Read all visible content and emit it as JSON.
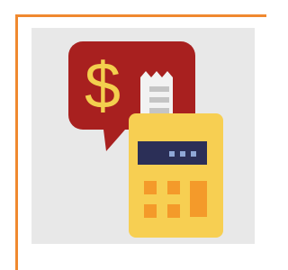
{
  "colors": {
    "frame": "#f0892f",
    "panel": "#e8e8e8",
    "bubble": "#a8201f",
    "dollar": "#f3cf4e",
    "receipt": "#f2f2f2",
    "receipt_lines": "#c4c4c4",
    "calculator_body": "#f7cf52",
    "calculator_screen": "#2b2f57",
    "screen_dots": "#8fa7d6",
    "keys": "#f49a2a"
  },
  "icon": {
    "name": "calculator-receipt-payment-icon",
    "dollar_symbol": "$"
  }
}
